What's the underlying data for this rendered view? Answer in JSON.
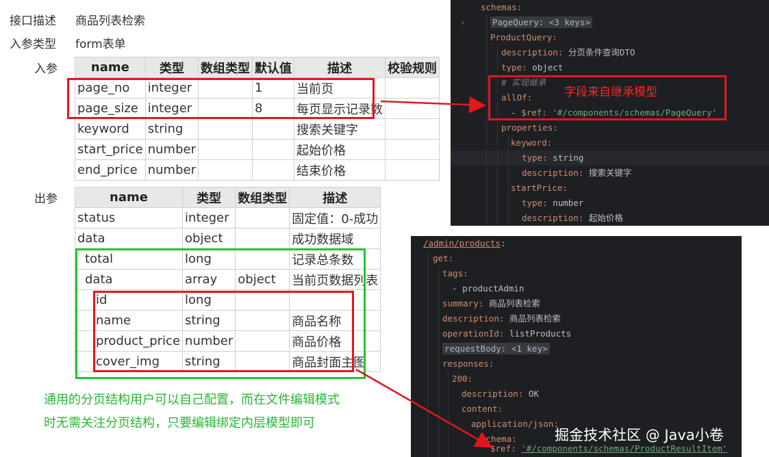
{
  "meta": {
    "desc_label": "接口描述",
    "desc_value": "商品列表检索",
    "param_type_label": "入参类型",
    "param_type_value": "form表单",
    "input_label": "入参",
    "output_label": "出参"
  },
  "input_table": {
    "headers": [
      "name",
      "类型",
      "数组类型",
      "默认值",
      "描述",
      "校验规则"
    ],
    "rows": [
      [
        "page_no",
        "integer",
        "",
        "1",
        "当前页",
        ""
      ],
      [
        "page_size",
        "integer",
        "",
        "8",
        "每页显示记录数",
        ""
      ],
      [
        "keyword",
        "string",
        "",
        "",
        "搜索关键字",
        ""
      ],
      [
        "start_price",
        "number",
        "",
        "",
        "起始价格",
        ""
      ],
      [
        "end_price",
        "number",
        "",
        "",
        "结束价格",
        ""
      ]
    ]
  },
  "output_table": {
    "headers": [
      "name",
      "类型",
      "数组类型",
      "描述"
    ],
    "rows": [
      [
        "status",
        "integer",
        "",
        "固定值：0-成功"
      ],
      [
        "data",
        "object",
        "",
        "成功数据域"
      ],
      [
        "total",
        "long",
        "",
        "记录总条数"
      ],
      [
        "data",
        "array",
        "object",
        "当前页数据列表"
      ],
      [
        "id",
        "long",
        "",
        ""
      ],
      [
        "name",
        "string",
        "",
        "商品名称"
      ],
      [
        "product_price",
        "number",
        "",
        "商品价格"
      ],
      [
        "cover_img",
        "string",
        "",
        "商品封面主图"
      ]
    ]
  },
  "note_lines": [
    "通用的分页结构用户可以自己配置，而在文件编辑模式",
    "时无需关注分页结构，只要编辑绑定内层模型即可"
  ],
  "code1_annotation": "字段来自继承模型",
  "watermark": "掘金技术社区 @ Java小卷",
  "code1": {
    "l1": "schemas:",
    "l2": "PageQuery: <3 keys>",
    "l3": "ProductQuery:",
    "l4k": "description:",
    "l4v": "分页条件查询DTO",
    "l5k": "type:",
    "l5v": "object",
    "l6": "# 实现继承",
    "l7": "allOf:",
    "l8a": "- ",
    "l8k": "$ref:",
    "l8v": "'#/components/schemas/PageQuery'",
    "l9": "properties:",
    "l10": "keyword:",
    "l11k": "type:",
    "l11v": "string",
    "l12k": "description:",
    "l12v": "搜索关键字",
    "l13": "startPrice:",
    "l14k": "type:",
    "l14v": "number",
    "l15k": "description:",
    "l15v": "起始价格"
  },
  "code2": {
    "l1": "/admin/products",
    "l1b": ":",
    "l2": "get:",
    "l3": "tags:",
    "l4a": "- ",
    "l4v": "productAdmin",
    "l5k": "summary:",
    "l5v": "商品列表检索",
    "l6k": "description:",
    "l6v": "商品列表检索",
    "l7k": "operationId:",
    "l7v": "listProducts",
    "l8": "requestBody: <1 key>",
    "l9": "responses:",
    "l10": "200:",
    "l11k": "description:",
    "l11v": "OK",
    "l12": "content:",
    "l13": "application/json:",
    "l14": "schema:",
    "l15k": "$ref:",
    "l15v": "'#/components/schemas/ProductResultItem'"
  },
  "colors": {
    "red_highlight": "#e4161d",
    "green_highlight": "#21c42c",
    "note_text": "#27b634",
    "code_bg": "#1e1f22",
    "yaml_key": "#cf8e6d",
    "yaml_string": "#6aab73"
  }
}
